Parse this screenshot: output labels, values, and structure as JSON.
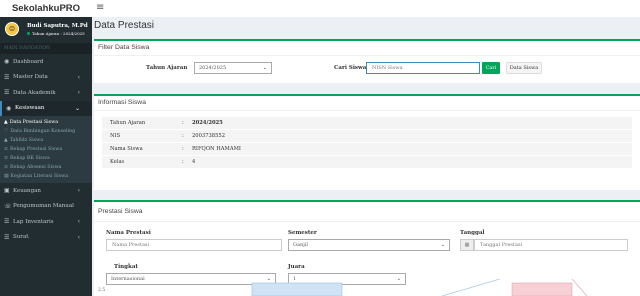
{
  "brand": "SekolahkuPRO",
  "user": {
    "name": "Budi Saputra, M.Pd",
    "status": "Tahun Ajaran : 2024/2025"
  },
  "nav_header": "MAIN NAVIGATION",
  "menu": [
    {
      "label": "Dashboard",
      "icon": "◉"
    },
    {
      "label": "Master Data",
      "icon": "☰"
    },
    {
      "label": "Data Akademik",
      "icon": "☰"
    },
    {
      "label": "Kesiswaan",
      "icon": "◉"
    }
  ],
  "submenu": [
    {
      "label": "Data Prestasi Siswa",
      "icon": "▲"
    },
    {
      "label": "Data Bimbingan Konseling",
      "icon": "♡"
    },
    {
      "label": "Tahfidz Siswa",
      "icon": "▲"
    },
    {
      "label": "Rekap Prestasi Siswa",
      "icon": "≡"
    },
    {
      "label": "Rekap BK Siswa",
      "icon": "≡"
    },
    {
      "label": "Rekap Absensi Siswa",
      "icon": "≡"
    },
    {
      "label": "Kegiatan Literasi Siswa",
      "icon": "▤"
    }
  ],
  "menu2": [
    {
      "label": "Keuangan",
      "icon": "▣"
    },
    {
      "label": "Pengumuman Manual",
      "icon": "☏"
    },
    {
      "label": "Lap Inventaris",
      "icon": "☰"
    },
    {
      "label": "Surat",
      "icon": "☰"
    }
  ],
  "page_title": "Data Prestasi",
  "filter": {
    "heading": "Filter Data Siswa",
    "tahun_label": "Tahun Ajaran",
    "tahun_value": "2024/2025",
    "cari_label": "Cari Siswa",
    "cari_placeholder": "NISN Siswa",
    "cari_button": "Cari",
    "data_button": "Data Siswa"
  },
  "info": {
    "heading": "Informasi Siswa",
    "rows": [
      {
        "key": "Tahun Ajaran",
        "value": "2024/2025"
      },
      {
        "key": "NIS",
        "value": "2003738552"
      },
      {
        "key": "Nama Siswa",
        "value": "RIFQON HAMAMI"
      },
      {
        "key": "Kelas",
        "value": "4"
      }
    ]
  },
  "prestasi": {
    "heading": "Prestasi Siswa",
    "nama_label": "Nama Prestasi",
    "nama_placeholder": "Nama Prestasi",
    "semester_label": "Semester",
    "semester_value": "Ganjil",
    "tanggal_label": "Tanggal",
    "tanggal_placeholder": "Tanggal Prestasi",
    "tingkat_label": "Tingkat",
    "tingkat_value": "Internasional",
    "juara_label": "Juara",
    "juara_value": "1"
  },
  "chart_hint": "2.5",
  "colors": {
    "accent": "#00a65a",
    "sidebar": "#222d32",
    "header_bg": "#ecf0f5"
  }
}
